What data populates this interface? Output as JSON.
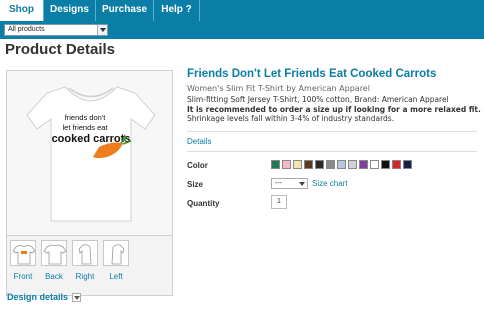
{
  "nav": {
    "tabs": [
      {
        "label": "Shop"
      },
      {
        "label": "Designs"
      },
      {
        "label": "Purchase"
      },
      {
        "label": "Help ?"
      }
    ]
  },
  "filter": {
    "selected": "All products"
  },
  "page": {
    "title": "Product Details"
  },
  "product": {
    "title": "Friends Don't Let Friends Eat Cooked Carrots",
    "subtitle": "Women's Slim Fit T-Shirt by American Apparel",
    "description": "Slim-fitting Soft Jersey T-Shirt, 100% cotton, Brand: American Apparel",
    "note": "It is recommended to order a size up if looking for a more relaxed fit.",
    "note_tail": " Shrinkage levels fall within 3-4% of industry standards.",
    "details_link": "Details",
    "shirt_text": [
      "friends don't",
      "let friends eat",
      "cooked carrots"
    ]
  },
  "views": [
    {
      "label": "Front"
    },
    {
      "label": "Back"
    },
    {
      "label": "Right"
    },
    {
      "label": "Left"
    }
  ],
  "design_details": "Design details",
  "options": {
    "color_label": "Color",
    "size_label": "Size",
    "quantity_label": "Quantity",
    "size_value": "---",
    "size_chart": "Size chart",
    "quantity_value": "1",
    "colors": [
      "#1e7d55",
      "#f7b7c9",
      "#f3e7b0",
      "#5a3a22",
      "#2b2b2b",
      "#8a8a8a",
      "#b7c7dc",
      "#cfd3d6",
      "#7e3fa0",
      "#ffffff",
      "#111111",
      "#d7262a",
      "#12204a"
    ]
  },
  "colors": {
    "brand": "#0a7ea6",
    "carrot": "#ef7c1e"
  }
}
